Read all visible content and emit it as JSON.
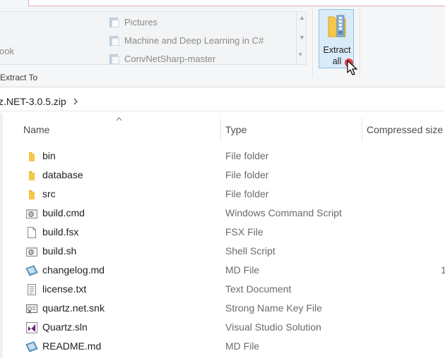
{
  "ribbon": {
    "destinations": [
      {
        "label": "Pictures",
        "icon": "pictures-folder-icon"
      },
      {
        "label": "Machine and Deep Learning in C#",
        "icon": "folder-icon"
      },
      {
        "label": "ConvNetSharp-master",
        "icon": "folder-icon"
      }
    ],
    "partial_item": "ook",
    "group_label": "Extract To",
    "extract_all_line1": "Extract",
    "extract_all_line2": "all"
  },
  "address": {
    "path": "z.NET-3.0.5.zip"
  },
  "columns": {
    "name": "Name",
    "type": "Type",
    "compressed": "Compressed size"
  },
  "files": [
    {
      "name": "bin",
      "type": "File folder",
      "icon": "folder-icon",
      "compressed": ""
    },
    {
      "name": "database",
      "type": "File folder",
      "icon": "folder-icon",
      "compressed": ""
    },
    {
      "name": "src",
      "type": "File folder",
      "icon": "folder-icon",
      "compressed": ""
    },
    {
      "name": "build.cmd",
      "type": "Windows Command Script",
      "icon": "script-gear-icon",
      "compressed": ""
    },
    {
      "name": "build.fsx",
      "type": "FSX File",
      "icon": "blank-file-icon",
      "compressed": ""
    },
    {
      "name": "build.sh",
      "type": "Shell Script",
      "icon": "script-gear-icon",
      "compressed": ""
    },
    {
      "name": "changelog.md",
      "type": "MD File",
      "icon": "md-file-icon",
      "compressed": "1"
    },
    {
      "name": "license.txt",
      "type": "Text Document",
      "icon": "text-file-icon",
      "compressed": ""
    },
    {
      "name": "quartz.net.snk",
      "type": "Strong Name Key File",
      "icon": "certificate-icon",
      "compressed": ""
    },
    {
      "name": "Quartz.sln",
      "type": "Visual Studio Solution",
      "icon": "visual-studio-icon",
      "compressed": ""
    },
    {
      "name": "README.md",
      "type": "MD File",
      "icon": "md-file-icon",
      "compressed": ""
    }
  ],
  "colors": {
    "folder": "#f5c84c",
    "extract_highlight": "#d9ebf8",
    "vs_purple": "#68217a"
  }
}
